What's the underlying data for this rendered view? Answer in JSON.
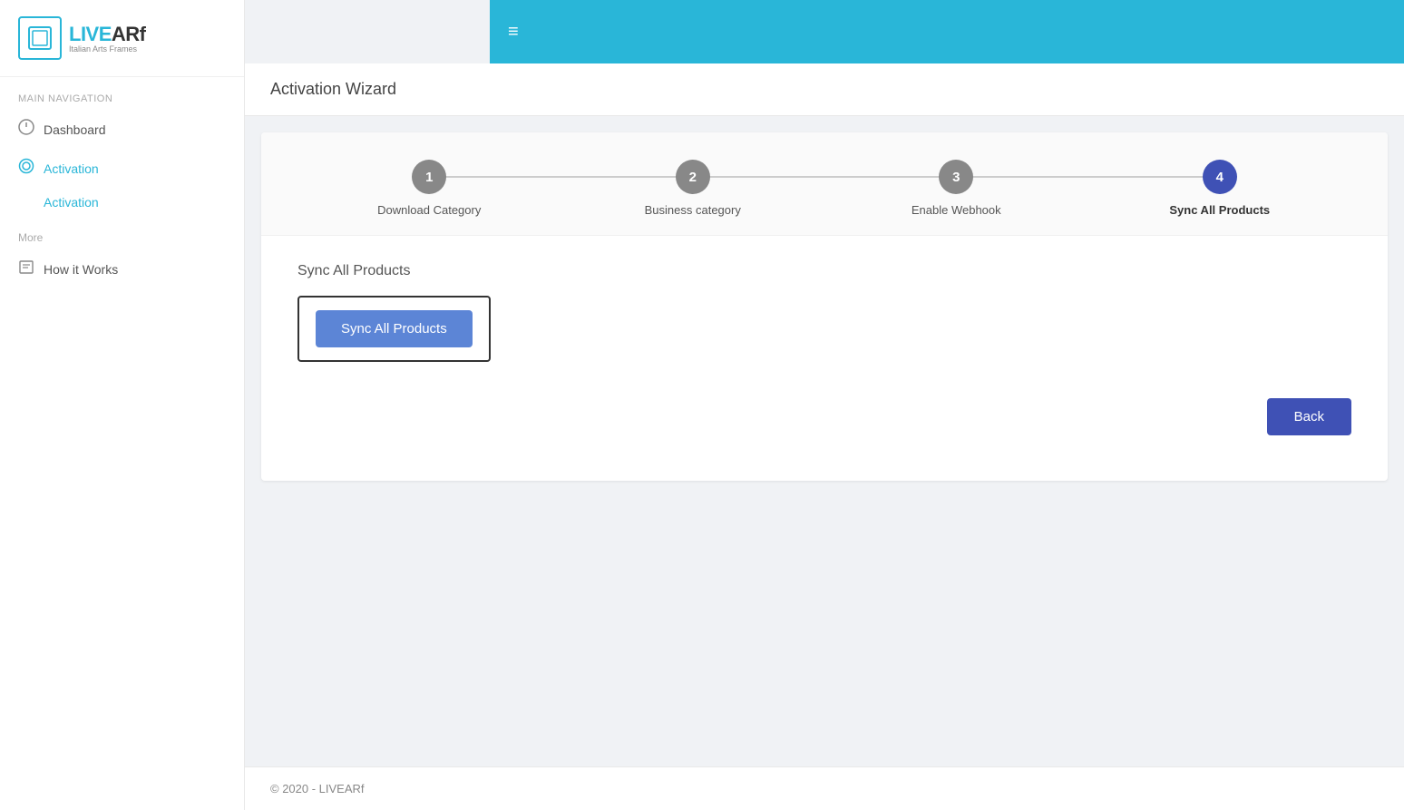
{
  "brand": {
    "name": "LIVEARf",
    "name_styled": "LIVE",
    "name_accent": "ARf",
    "tagline": "Italian Arts Frames"
  },
  "sidebar": {
    "nav_label": "Main Navigation",
    "items": [
      {
        "id": "dashboard",
        "label": "Dashboard",
        "icon": "○"
      },
      {
        "id": "activation",
        "label": "Activation",
        "icon": "◎",
        "active": true
      }
    ],
    "sub_items": [
      {
        "id": "activation-sub",
        "label": "Activation"
      }
    ],
    "more_label": "More",
    "more_items": [
      {
        "id": "how-it-works",
        "label": "How it Works",
        "icon": "📋"
      }
    ]
  },
  "topbar": {
    "menu_icon": "≡"
  },
  "page": {
    "title": "Activation Wizard"
  },
  "wizard": {
    "steps": [
      {
        "number": "1",
        "label": "Download Category",
        "active": false
      },
      {
        "number": "2",
        "label": "Business category",
        "active": false
      },
      {
        "number": "3",
        "label": "Enable Webhook",
        "active": false
      },
      {
        "number": "4",
        "label": "Sync All Products",
        "active": true
      }
    ],
    "body_title": "Sync All Products",
    "sync_button_label": "Sync All Products",
    "back_button_label": "Back"
  },
  "footer": {
    "text": "© 2020 - LIVEARf"
  }
}
